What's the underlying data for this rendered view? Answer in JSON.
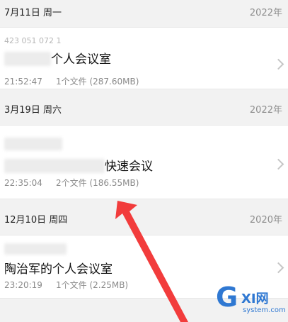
{
  "sections": [
    {
      "date": "7月11日 周一",
      "year": "2022年",
      "item": {
        "meeting_id": "423 051 072 1",
        "title": "个人会议室",
        "time": "21:52:47",
        "files": "1个文件 (287.60MB)"
      }
    },
    {
      "date": "3月19日 周六",
      "year": "2022年",
      "item": {
        "meeting_id": "",
        "title": "快速会议",
        "time": "22:35:04",
        "files": "2个文件 (186.55MB)"
      }
    },
    {
      "date": "12月10日 周四",
      "year": "2020年",
      "item": {
        "meeting_id": "",
        "title": "陶治军的个人会议室",
        "time": "23:20:19",
        "files": "1个文件 (2.25MB)"
      }
    }
  ],
  "watermark": {
    "logo": "G",
    "name": "XI网",
    "site": "system.com"
  },
  "colors": {
    "background": "#f2f2f2",
    "card": "#ffffff",
    "arrow": "#f23c3c",
    "watermark": "#2f78d2"
  },
  "icons": {
    "chevron": "chevron-right-icon",
    "arrow": "red-arrow"
  }
}
